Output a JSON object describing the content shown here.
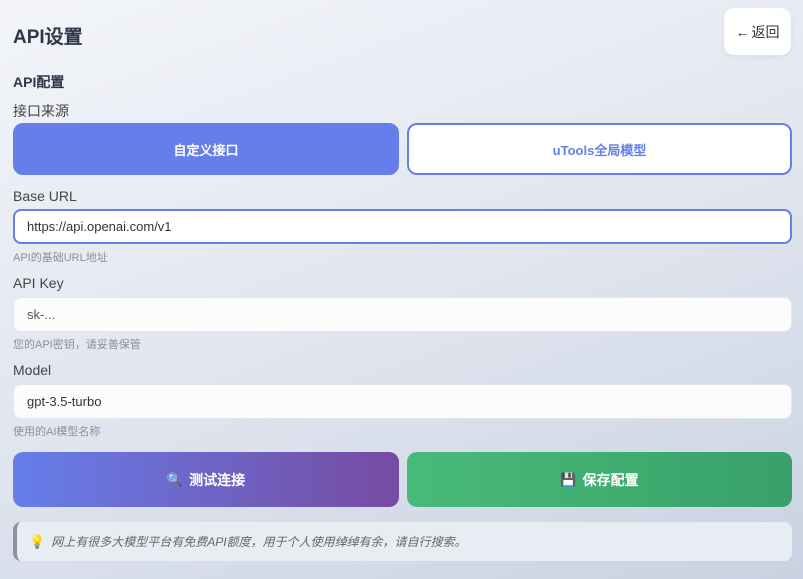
{
  "header": {
    "title": "API设置",
    "back_label": "返回",
    "back_icon": "←"
  },
  "api_config": {
    "section_title": "API配置",
    "source_label": "接口来源",
    "source_options": [
      "自定义接口",
      "uTools全局模型"
    ],
    "selected_source": "自定义接口",
    "base_url": {
      "label": "Base URL",
      "value": "https://api.openai.com/v1",
      "hint": "API的基础URL地址"
    },
    "api_key": {
      "label": "API Key",
      "placeholder": "sk-...",
      "value": "",
      "hint": "您的API密钥，请妥善保管"
    },
    "model": {
      "label": "Model",
      "value": "gpt-3.5-turbo",
      "hint": "使用的AI模型名称"
    }
  },
  "actions": {
    "test_label": "测试连接",
    "test_icon": "🔍",
    "save_label": "保存配置",
    "save_icon": "💾"
  },
  "tip": {
    "icon": "💡",
    "text": "网上有很多大模型平台有免费API额度，用于个人使用绰绰有余，请自行搜索。"
  },
  "colors": {
    "accent": "#667eea",
    "accent_gradient_end": "#764ba2",
    "save_green": "#48bb78",
    "save_green_end": "#38a169"
  }
}
